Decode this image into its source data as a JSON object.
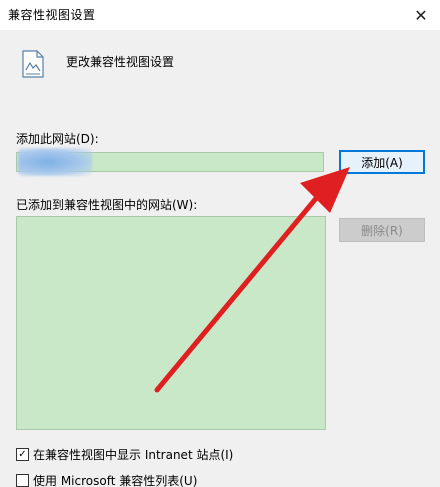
{
  "window": {
    "title": "兼容性视图设置",
    "close_glyph": "✕"
  },
  "header": {
    "text": "更改兼容性视图设置",
    "icon": "document-settings-icon"
  },
  "add_site": {
    "label": "添加此网站(D):",
    "value": "",
    "button_label": "添加(A)"
  },
  "site_list": {
    "label": "已添加到兼容性视图中的网站(W):",
    "items": [],
    "remove_button_label": "删除(R)"
  },
  "options": [
    {
      "label": "在兼容性视图中显示 Intranet 站点(I)",
      "checked": true
    },
    {
      "label": "使用 Microsoft 兼容性列表(U)",
      "checked": false
    }
  ],
  "colors": {
    "input_background": "#c9e8c8",
    "primary_button_border": "#0078d7",
    "annotation_arrow": "#e02020"
  }
}
